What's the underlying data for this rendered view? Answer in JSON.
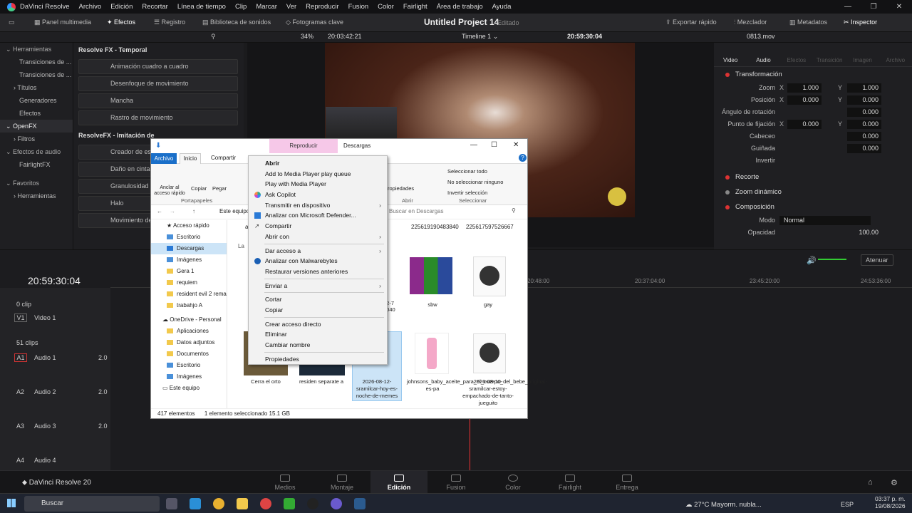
{
  "menubar": {
    "app": "DaVinci Resolve",
    "items": [
      "Archivo",
      "Edición",
      "Recortar",
      "Línea de tiempo",
      "Clip",
      "Marcar",
      "Ver",
      "Reproducir",
      "Fusion",
      "Color",
      "Fairlight",
      "Área de trabajo",
      "Ayuda"
    ]
  },
  "toolbar": {
    "panel_multimedia": "Panel multimedia",
    "efectos": "Efectos",
    "registro": "Registro",
    "biblioteca": "Biblioteca de sonidos",
    "fotogramas": "Fotogramas clave",
    "project": "Untitled Project 14",
    "status": "Editado",
    "exportar": "Exportar rápido",
    "mezclador": "Mezclador",
    "metadatos": "Metadatos",
    "inspector": "Inspector"
  },
  "viewerbar": {
    "zoom": "34%",
    "timecode": "20:03:42:21",
    "timeline": "Timeline 1",
    "tc_right": "20:59:30:04",
    "file": "0813.mov"
  },
  "sidebar": {
    "herramientas": "Herramientas",
    "transiciones_video": "Transiciones de ...",
    "transiciones_audio": "Transiciones de ...",
    "titulos": "Títulos",
    "generadores": "Generadores",
    "efectos": "Efectos",
    "openfx": "OpenFX",
    "filtros": "Filtros",
    "efectos_audio": "Efectos de audio",
    "fairlightfx": "FairlightFX",
    "favoritos": "Favoritos",
    "fav_herr": "Herramientas"
  },
  "fxpanel": {
    "header1": "Resolve FX - Temporal",
    "items1": [
      "Animación cuadro a cuadro",
      "Desenfoque de movimiento",
      "Mancha",
      "Rastro de movimiento"
    ],
    "header2": "ResolveFX - Imitación de",
    "items2": [
      "Creador de esté",
      "Daño en cinta",
      "Granulosidad",
      "Halo",
      "Movimiento de c"
    ]
  },
  "inspector": {
    "tabs": [
      "Video",
      "Audio",
      "Efectos",
      "Transición",
      "Imagen",
      "Archivo"
    ],
    "transform": "Transformación",
    "zoom": "Zoom",
    "zoom_x": "1.000",
    "zoom_y": "1.000",
    "posicion": "Posición",
    "pos_x": "0.000",
    "pos_y": "0.000",
    "angulo": "Ángulo de rotación",
    "angulo_v": "0.000",
    "fijacion": "Punto de fijación",
    "fij_x": "0.000",
    "fij_y": "0.000",
    "cabeceo": "Cabeceo",
    "cabeceo_v": "0.000",
    "guinada": "Guiñada",
    "guinada_v": "0.000",
    "invertir": "Invertir",
    "recorte": "Recorte",
    "zoom_din": "Zoom dinámico",
    "composicion": "Composición",
    "modo": "Modo",
    "modo_v": "Normal",
    "opacidad": "Opacidad",
    "opacidad_v": "100.00",
    "x": "X",
    "y": "Y"
  },
  "timeline": {
    "tc": "20:59:30:04",
    "atenuar": "Atenuar",
    "ruler": [
      "20:48:00",
      "20:37:04:00",
      "23:45:20:00",
      "24:53:36:00"
    ],
    "v1_clips": "0 clip",
    "v1": "V1",
    "video1": "Video 1",
    "v1_count": "51 clips",
    "a1": "A1",
    "audio1": "Audio 1",
    "a2": "A2",
    "audio2": "Audio 2",
    "a3": "A3",
    "audio3": "Audio 3",
    "a4": "A4",
    "audio4": "Audio 4",
    "vol": "2.0"
  },
  "pages": {
    "brand": "DaVinci Resolve 20",
    "items": [
      "Medios",
      "Montaje",
      "Edición",
      "Fusion",
      "Color",
      "Fairlight",
      "Entrega"
    ]
  },
  "explorer": {
    "reproducir": "Reproducir",
    "descargas": "Descargas",
    "archivo": "Archivo",
    "inicio": "Inicio",
    "compartir": "Compartir",
    "anclar": "Anclar al acceso rápido",
    "copiar": "Copiar",
    "pegar": "Pegar",
    "portapapeles": "Portapapeles",
    "propiedades": "ropiedades",
    "abrir": "Abrir",
    "sel_todo": "Seleccionar todo",
    "no_sel": "No seleccionar ninguno",
    "inv_sel": "Invertir selección",
    "seleccionar": "Seleccionar",
    "addr": "Este equipo",
    "search_ph": "Buscar en Descargas",
    "nav": [
      "Acceso rápido",
      "Escritorio",
      "Descargas",
      "Imágenes",
      "Gera 1",
      "requiem",
      "resident evil 2 rema",
      "trabahjo A",
      "OneDrive - Personal",
      "Aplicaciones",
      "Datos adjuntos",
      "Documentos",
      "Escritorio",
      "Imágenes",
      "Este equipo"
    ],
    "top_files": [
      "225619190483840",
      "225617597526667"
    ],
    "files": [
      {
        "name": "sbw"
      },
      {
        "name": "gay"
      },
      {
        "name": "Cerra el orto"
      },
      {
        "name": "residen separate a"
      },
      {
        "name": "2026-08-12-sramilcar-hoy-es-noche-de-memes"
      },
      {
        "name": "johnsons_baby_aceite_para_el_cuerpo_del_bebe_original-es-pa"
      },
      {
        "name": "2026-08-10-sramilcar-estoy-empachado-de-tanto-jueguito"
      }
    ],
    "partial": "52-7 5040",
    "al": "al",
    "la": "La",
    "count": "417 elementos",
    "selected": "1 elemento seleccionado 15.1 GB"
  },
  "context": {
    "items": [
      "Abrir",
      "Add to Media Player play queue",
      "Play with Media Player",
      "Ask Copilot",
      "Transmitir en dispositivo",
      "Analizar con Microsoft Defender...",
      "Compartir",
      "Abrir con",
      "Dar acceso a",
      "Analizar con Malwarebytes",
      "Restaurar versiones anteriores",
      "Enviar a",
      "Cortar",
      "Copiar",
      "Crear acceso directo",
      "Eliminar",
      "Cambiar nombre",
      "Propiedades"
    ]
  },
  "taskbar": {
    "search": "Buscar",
    "weather": "27°C Mayorm. nubla...",
    "lang": "ESP",
    "time": "03:37 p. m.",
    "date": "19/08/2026"
  }
}
